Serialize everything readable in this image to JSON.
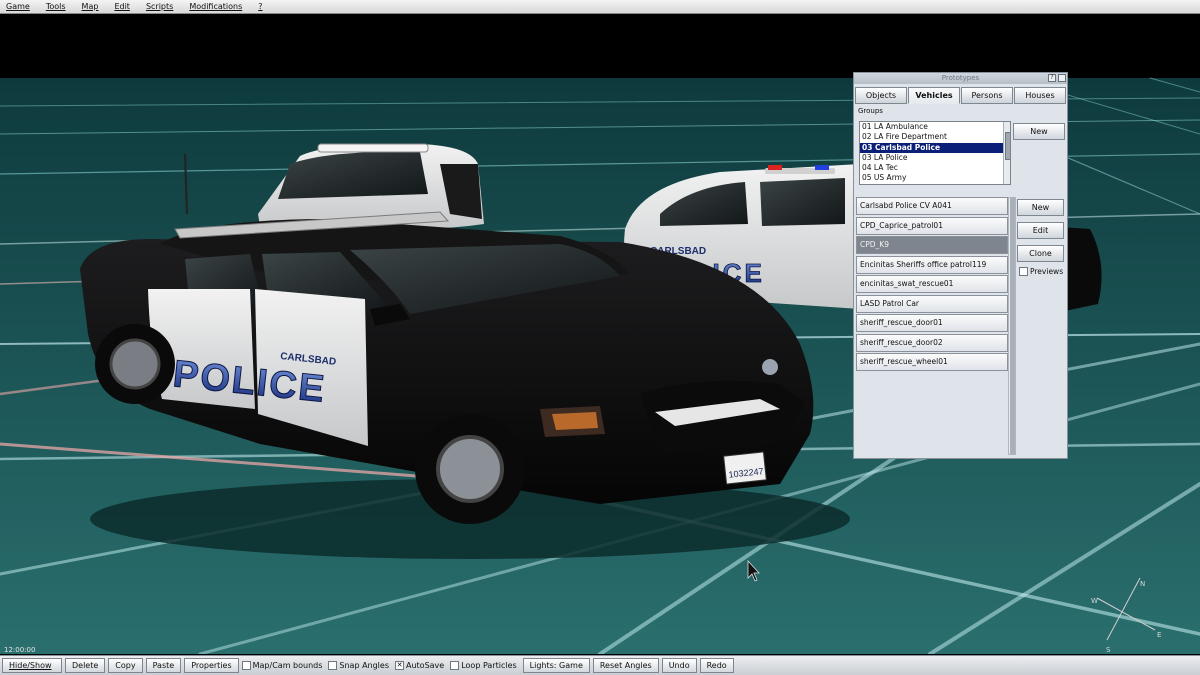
{
  "menu": [
    "Game",
    "Tools",
    "Map",
    "Edit",
    "Scripts",
    "Modifications",
    "?"
  ],
  "viewport": {
    "clock": "12:00:00",
    "car_front_label": "POLICE",
    "car_front_city": "CARLSBAD",
    "car_back_label": "POLICE",
    "car_back_city": "CARLSBAD",
    "license_plate": "1032247",
    "colors": {
      "ground": "#1f5a5a",
      "grid": "#9fe8ec",
      "sky": "#000000"
    }
  },
  "prototypes": {
    "title": "Prototypes",
    "help_btn": "?",
    "close_btn": "",
    "tabs": [
      {
        "label": "Objects",
        "active": false
      },
      {
        "label": "Vehicles",
        "active": true
      },
      {
        "label": "Persons",
        "active": false
      },
      {
        "label": "Houses",
        "active": false
      }
    ],
    "groups_label": "Groups",
    "groups": [
      {
        "label": "01 LA Ambulance",
        "selected": false
      },
      {
        "label": "02 LA Fire Department",
        "selected": false
      },
      {
        "label": "03 Carlsbad Police",
        "selected": true
      },
      {
        "label": "03 LA Police",
        "selected": false
      },
      {
        "label": "04 LA Tec",
        "selected": false
      },
      {
        "label": "05 US Army",
        "selected": false
      }
    ],
    "group_new_btn": "New",
    "vehicles": [
      {
        "label": "Carlsabd Police CV A041",
        "selected": false
      },
      {
        "label": "CPD_Caprice_patrol01",
        "selected": false
      },
      {
        "label": "CPD_K9",
        "selected": true
      },
      {
        "label": "Encinitas Sheriffs office patrol119",
        "selected": false
      },
      {
        "label": "encinitas_swat_rescue01",
        "selected": false
      },
      {
        "label": "LASD Patrol Car",
        "selected": false
      },
      {
        "label": "sheriff_rescue_door01",
        "selected": false
      },
      {
        "label": "sheriff_rescue_door02",
        "selected": false
      },
      {
        "label": "sheriff_rescue_wheel01",
        "selected": false
      }
    ],
    "new_btn": "New",
    "edit_btn": "Edit",
    "clone_btn": "Clone",
    "previews_label": "Previews",
    "previews_checked": false
  },
  "compass": {
    "n": "N",
    "e": "E",
    "s": "S",
    "w": "W"
  },
  "toolbar": {
    "hide_show": "Hide/Show",
    "delete": "Delete",
    "copy": "Copy",
    "paste": "Paste",
    "properties": "Properties",
    "map_cam_bounds": "Map/Cam bounds",
    "map_cam_bounds_checked": false,
    "snap_angles": "Snap Angles",
    "snap_angles_checked": false,
    "autosave": "AutoSave",
    "autosave_checked": true,
    "loop_particles": "Loop Particles",
    "loop_particles_checked": false,
    "lights": "Lights: Game",
    "reset_angles": "Reset Angles",
    "undo": "Undo",
    "redo": "Redo"
  }
}
